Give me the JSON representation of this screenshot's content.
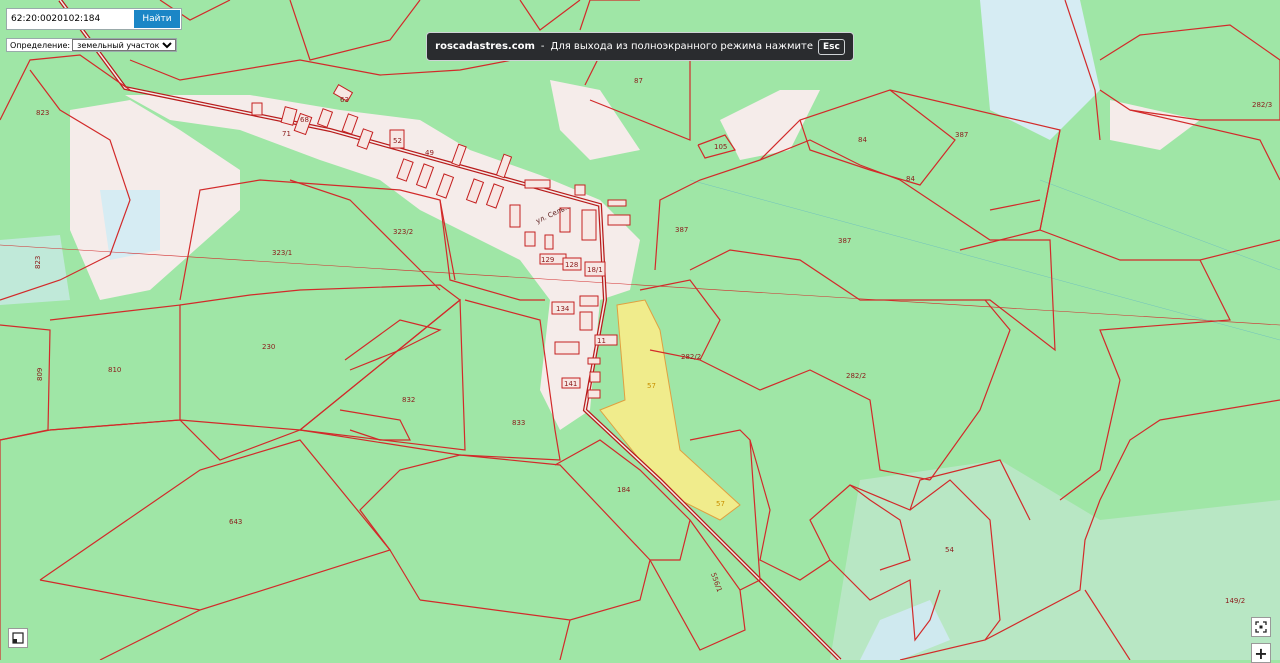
{
  "search": {
    "value": "62:20:0020102:184",
    "button_label": "Найти"
  },
  "definition": {
    "label": "Определение:",
    "selected": "земельный участок"
  },
  "banner": {
    "site": "roscadastres.com",
    "separator": "-",
    "message": "Для выхода из полноэкранного режима нажмите",
    "key": "Esc"
  },
  "controls": {
    "layers_icon": "layers-icon",
    "fit_icon": "fullscreen-icon",
    "zoom_in": "+"
  },
  "colors": {
    "forest": "#9fe6a6",
    "parcel_border": "#d22a2a",
    "settlement": "#f5ecea",
    "water": "#d6ecf3",
    "highlight": "#f0ec8c"
  },
  "map": {
    "street_label": "ул. Сель...",
    "parcel_labels": [
      "823",
      "823",
      "809",
      "810",
      "230",
      "323/1",
      "323/2",
      "832",
      "833",
      "643",
      "184",
      "57",
      "57",
      "282/2",
      "282/2",
      "387",
      "387",
      "387",
      "84",
      "84",
      "87",
      "105",
      "54",
      "149/2",
      "282/3",
      "134",
      "129",
      "128",
      "18/1",
      "11",
      "141",
      "63",
      "68",
      "71",
      "52",
      "49",
      "556/1"
    ]
  }
}
